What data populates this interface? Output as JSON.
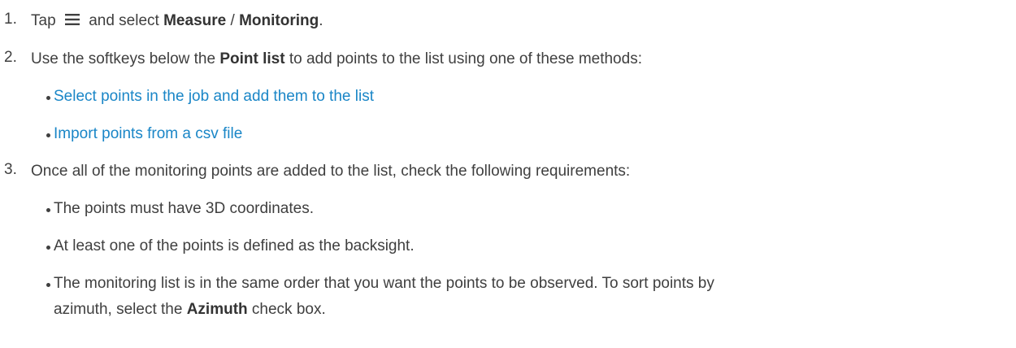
{
  "steps": [
    {
      "number": "1.",
      "text_before_icon": "Tap",
      "icon": "hamburger-menu-icon",
      "text_after_icon": "and select",
      "bold1": "Measure",
      "sep": " / ",
      "bold2": "Monitoring",
      "end": "."
    },
    {
      "number": "2.",
      "text_before": "Use the softkeys below the ",
      "bold": "Point list",
      "text_after": " to add points to the list using one of these methods:",
      "links": [
        "Select points in the job and add them to the list",
        "Import points from a csv file"
      ]
    },
    {
      "number": "3.",
      "text": "Once all of the monitoring points are added to the list, check the following requirements:",
      "bullets": [
        "The points must have 3D coordinates.",
        "At least one of the points is defined as the backsight."
      ],
      "last_bullet": {
        "line1": "The monitoring list is in the same order that you want the points to be observed. To sort points by",
        "line2_before": "azimuth, select the ",
        "line2_bold": "Azimuth",
        "line2_after": " check box."
      }
    }
  ],
  "colors": {
    "text": "#3f3f3f",
    "link": "#1a86c7"
  }
}
